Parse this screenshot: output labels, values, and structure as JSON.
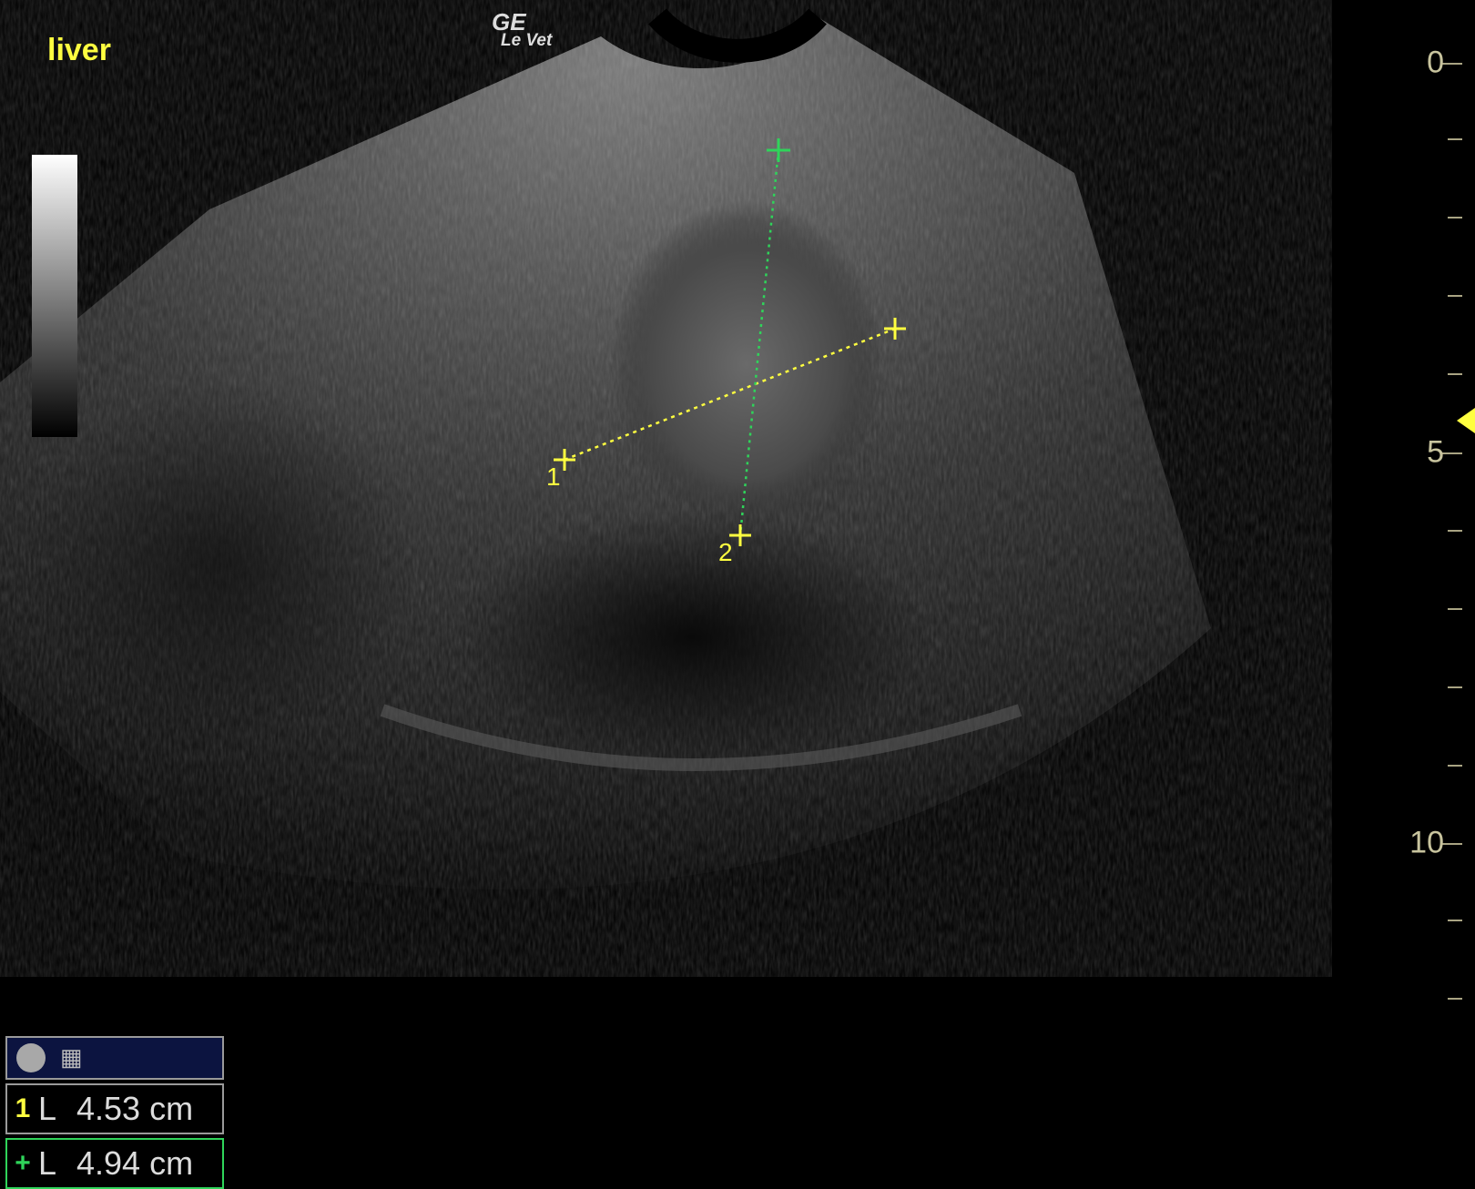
{
  "organ_label": "liver",
  "brand": {
    "logo": "GE",
    "model": "Le Vet"
  },
  "depth_scale": {
    "labels": [
      "0",
      "5",
      "10"
    ],
    "tick_color": "#a9a483",
    "focus_marker_depth_cm": 4.5
  },
  "calipers": {
    "caliper_1": {
      "label": "1",
      "color": "#ffff40"
    },
    "caliper_2": {
      "label": "2",
      "color": "#2fd45a"
    }
  },
  "measurements": [
    {
      "index": "1",
      "type": "L",
      "value": "4.53 cm",
      "color": "#ffff40"
    },
    {
      "index": "+",
      "type": "L",
      "value": "4.94 cm",
      "color": "#2fd45a"
    }
  ]
}
